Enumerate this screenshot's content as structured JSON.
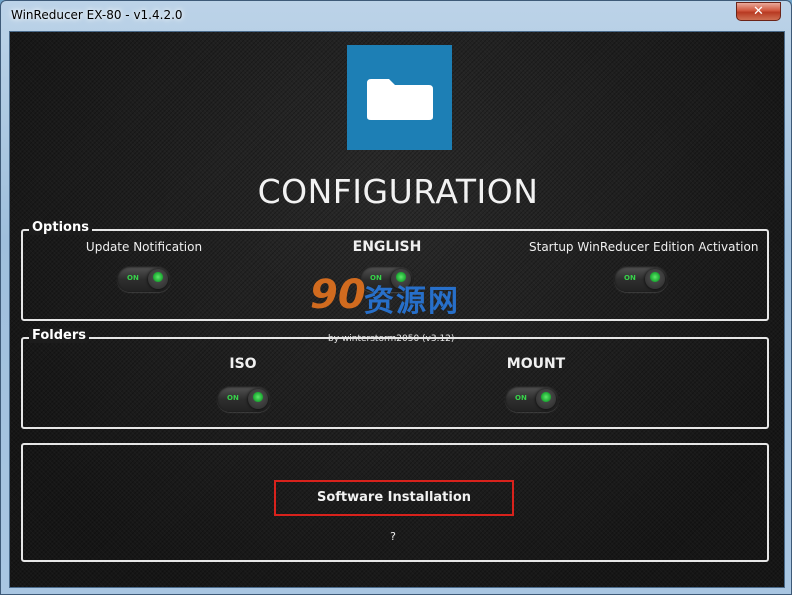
{
  "window": {
    "title": "WinReducer EX-80 - v1.4.2.0",
    "close_label": "✕"
  },
  "header": {
    "logo_icon": "folder-icon",
    "title": "CONFIGURATION"
  },
  "options": {
    "legend": "Options",
    "items": [
      {
        "label": "Update Notification",
        "toggle_text": "ON",
        "state": "on"
      },
      {
        "label": "ENGLISH",
        "toggle_text": "ON",
        "state": "on"
      },
      {
        "label": "Startup WinReducer Edition Activation",
        "toggle_text": "ON",
        "state": "on"
      }
    ]
  },
  "folders": {
    "legend": "Folders",
    "items": [
      {
        "label": "ISO",
        "toggle_text": "ON",
        "state": "on"
      },
      {
        "label": "MOUNT",
        "toggle_text": "ON",
        "state": "on"
      }
    ]
  },
  "watermark": {
    "big": "90",
    "cn": "资源网",
    "byline": "by winterstorm2050 (v3.12)"
  },
  "actions": {
    "install_label": "Software Installation",
    "help_label": "?"
  },
  "colors": {
    "accent_blue": "#1d7fb5",
    "highlight_red": "#d8221c",
    "toggle_green": "#37d24a"
  }
}
